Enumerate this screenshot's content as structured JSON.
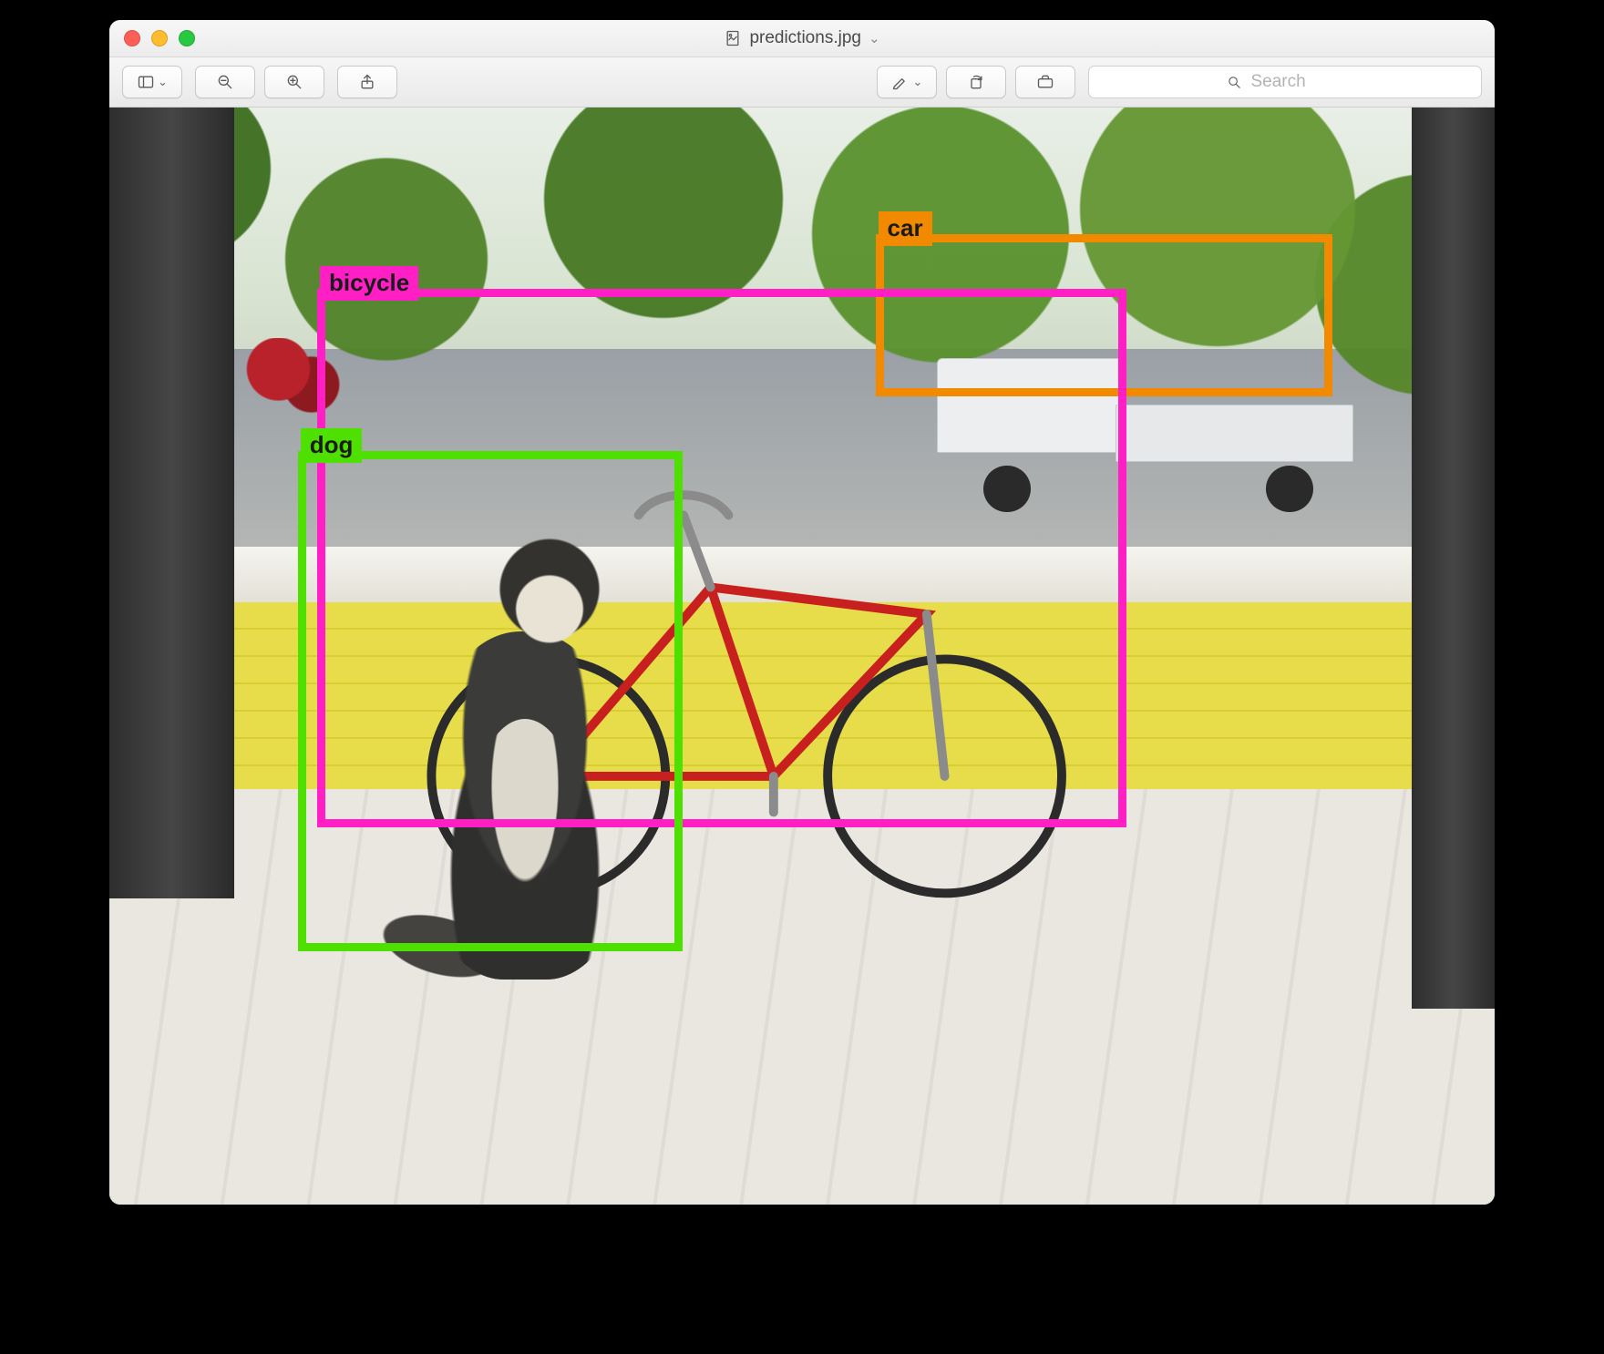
{
  "window": {
    "filename": "predictions.jpg"
  },
  "toolbar": {
    "search_placeholder": "Search"
  },
  "detections": {
    "car": {
      "label": "car"
    },
    "bicycle": {
      "label": "bicycle"
    },
    "dog": {
      "label": "dog"
    }
  }
}
